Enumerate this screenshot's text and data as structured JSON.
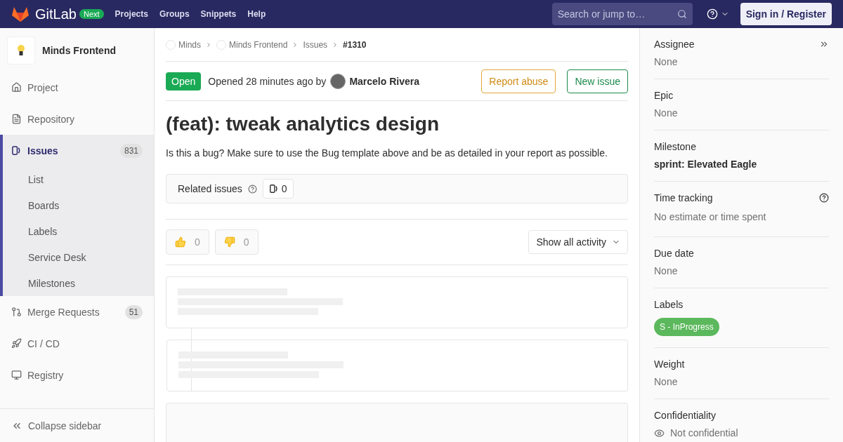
{
  "header": {
    "brand": "GitLab",
    "badge": "Next",
    "nav": [
      "Projects",
      "Groups",
      "Snippets",
      "Help"
    ],
    "search": {
      "placeholder": "Search or jump to…"
    },
    "sign_in": "Sign in / Register"
  },
  "sidebar": {
    "project": "Minds Frontend",
    "items": [
      {
        "label": "Project",
        "selected": false
      },
      {
        "label": "Repository",
        "selected": false
      },
      {
        "label": "Issues",
        "count": "831",
        "selected": true,
        "children": [
          {
            "label": "List"
          },
          {
            "label": "Boards"
          },
          {
            "label": "Labels"
          },
          {
            "label": "Service Desk"
          },
          {
            "label": "Milestones"
          }
        ]
      },
      {
        "label": "Merge Requests",
        "count": "51",
        "selected": false
      },
      {
        "label": "CI / CD",
        "selected": false
      },
      {
        "label": "Registry",
        "selected": false
      }
    ],
    "collapse": "Collapse sidebar"
  },
  "breadcrumbs": [
    "Minds",
    "Minds Frontend",
    "Issues",
    "#1310"
  ],
  "issue": {
    "status": "Open",
    "opened": "Opened 28 minutes ago by",
    "author": "Marcelo Rivera",
    "buttons": [
      "Report abuse",
      "New issue"
    ],
    "title": "(feat): tweak analytics design",
    "description": "Is this a bug? Make sure to use the Bug template above and be as detailed in your report as possible."
  },
  "related": {
    "label": "Related issues",
    "count": "0"
  },
  "reactions": [
    {
      "kind": "up",
      "count": "0"
    },
    {
      "kind": "down",
      "count": "0"
    }
  ],
  "activity_filter": "Show all activity",
  "notes": [
    {
      "kind": "skeleton"
    },
    {
      "kind": "skeleton"
    },
    {
      "kind": "empty"
    }
  ],
  "right_sidebar": [
    {
      "label": "Assignee",
      "value": "None",
      "kind": "plain"
    },
    {
      "label": "Epic",
      "value": "None",
      "kind": "plain"
    },
    {
      "label": "Milestone",
      "value": "sprint: Elevated Eagle",
      "kind": "bold"
    },
    {
      "label": "Time tracking",
      "value": "No estimate or time spent",
      "kind": "help"
    },
    {
      "label": "Due date",
      "value": "None",
      "kind": "plain"
    },
    {
      "label": "Labels",
      "value": "S - InProgress",
      "kind": "label",
      "color": "#5cb85c"
    },
    {
      "label": "Weight",
      "value": "None",
      "kind": "plain"
    },
    {
      "label": "Confidentiality",
      "value": "Not confidential",
      "kind": "eye"
    }
  ]
}
